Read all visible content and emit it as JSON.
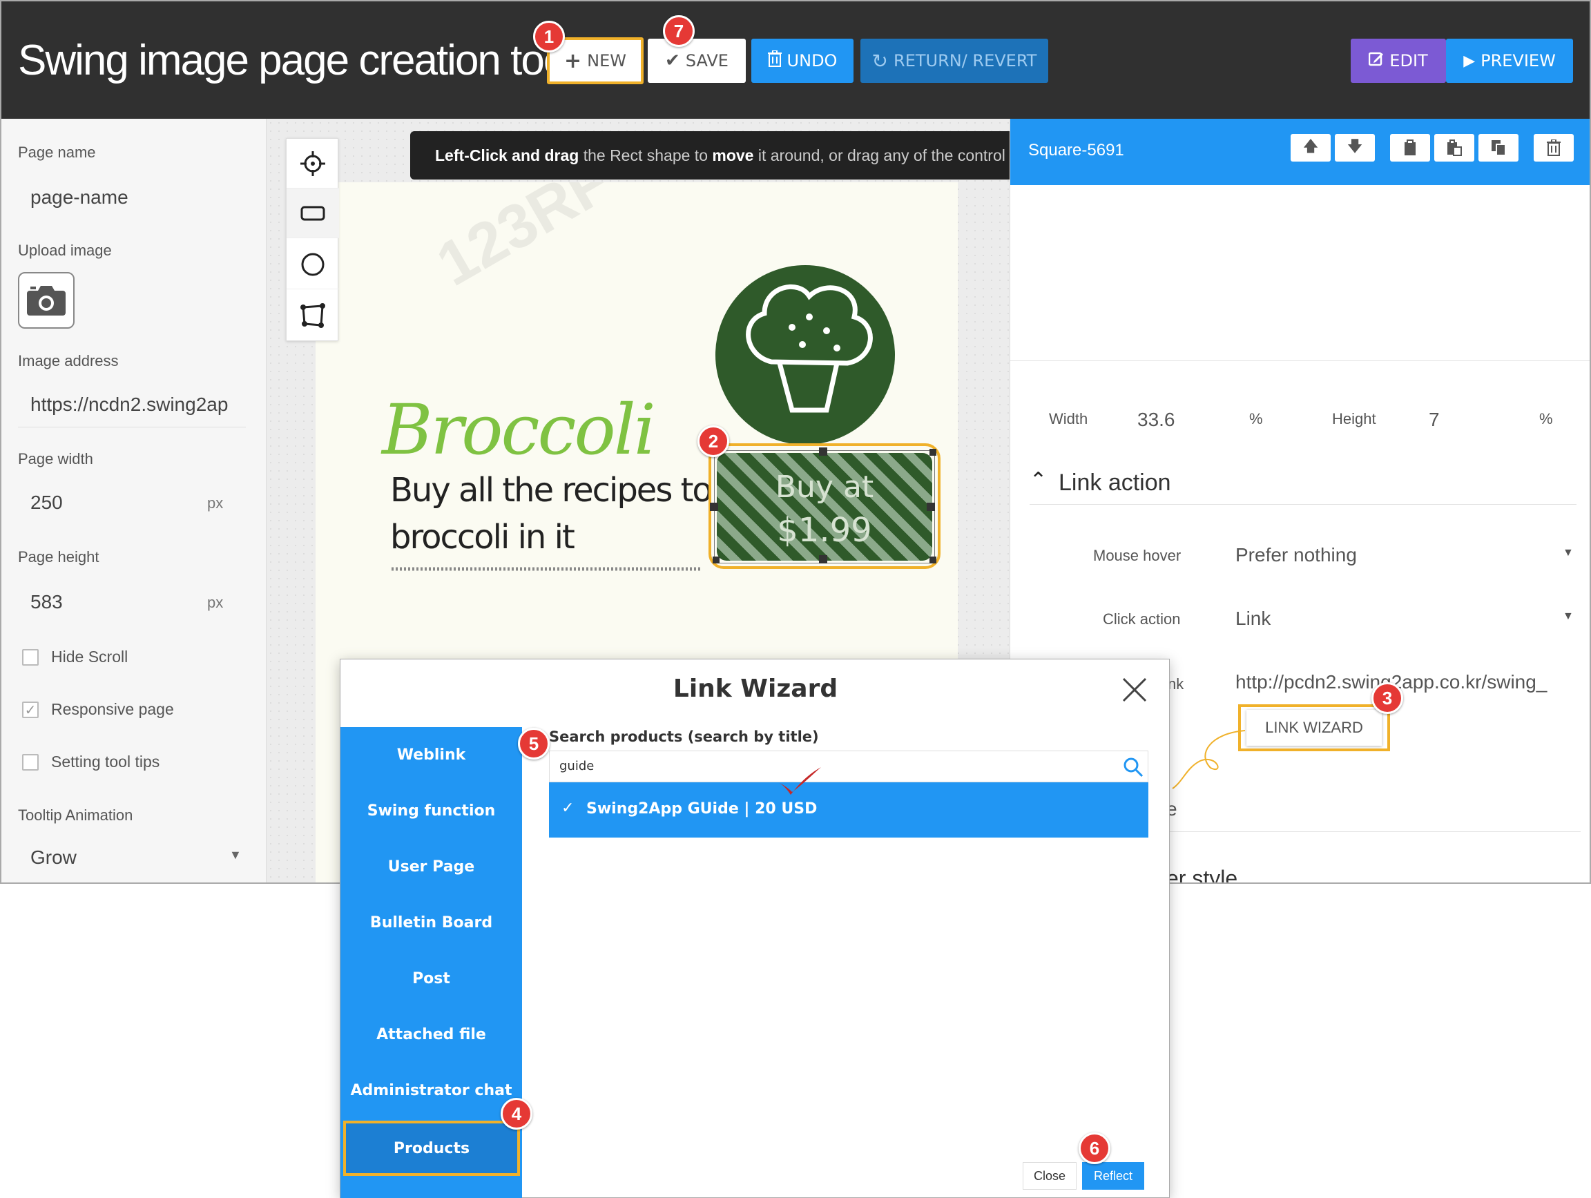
{
  "header": {
    "title": "Swing image page creation tool",
    "new_label": "NEW",
    "save_label": "SAVE",
    "undo_label": "UNDO",
    "revert_label": "RETURN/ REVERT",
    "edit_label": "EDIT",
    "preview_label": "PREVIEW"
  },
  "badges": [
    "1",
    "2",
    "3",
    "4",
    "5",
    "6",
    "7"
  ],
  "left_panel": {
    "page_name_label": "Page name",
    "page_name_value": "page-name",
    "upload_label": "Upload image",
    "image_address_label": "Image address",
    "image_address_value": "https://ncdn2.swing2ap",
    "page_width_label": "Page width",
    "page_width_value": "250",
    "page_height_label": "Page height",
    "page_height_value": "583",
    "unit": "px",
    "hide_scroll_label": "Hide Scroll",
    "hide_scroll_checked": false,
    "responsive_label": "Responsive page",
    "responsive_checked": true,
    "tooltips_label": "Setting tool tips",
    "tooltips_checked": false,
    "tooltip_animation_label": "Tooltip Animation",
    "tooltip_animation_value": "Grow"
  },
  "canvas": {
    "instruction_prefix_bold": "Left-Click and drag",
    "instruction_mid1": " the Rect shape to ",
    "instruction_bold2": "move",
    "instruction_rest": " it around, or drag any of the control p",
    "image_heading": "Broccoli",
    "image_line1": "Buy all the recipes to use",
    "image_line2": "broccoli in it",
    "shape_line1": "Buy at",
    "shape_line2": "$1.99"
  },
  "right_panel": {
    "title": "Square-5691",
    "width_label": "Width",
    "width_value": "33.6",
    "height_label": "Height",
    "height_value": "7",
    "percent": "%",
    "link_action_heading": "Link action",
    "mouse_hover_label": "Mouse hover",
    "mouse_hover_value": "Prefer nothing",
    "click_action_label": "Click action",
    "click_action_value": "Link",
    "link_label_fragment": "nk",
    "link_value": "http://pcdn2.swing2app.co.kr/swing_",
    "link_wizard_label": "LINK WIZARD",
    "partial_e": "e",
    "partial_style": "er style"
  },
  "wizard": {
    "title": "Link Wizard",
    "menu": [
      "Weblink",
      "Swing function",
      "User Page",
      "Bulletin Board",
      "Post",
      "Attached file",
      "Administrator chat",
      "Products"
    ],
    "search_label": "Search products (search by title)",
    "search_value": "guide",
    "result_label": "Swing2App GUide | 20 USD",
    "close_label": "Close",
    "reflect_label": "Reflect"
  },
  "colors": {
    "accent_blue": "#2196f3",
    "header_dark": "#303030",
    "highlight_yellow": "#f0b12a",
    "badge_red": "#e53935",
    "edit_purple": "#7c5ad4",
    "broccoli_green": "#2f5a2a"
  }
}
